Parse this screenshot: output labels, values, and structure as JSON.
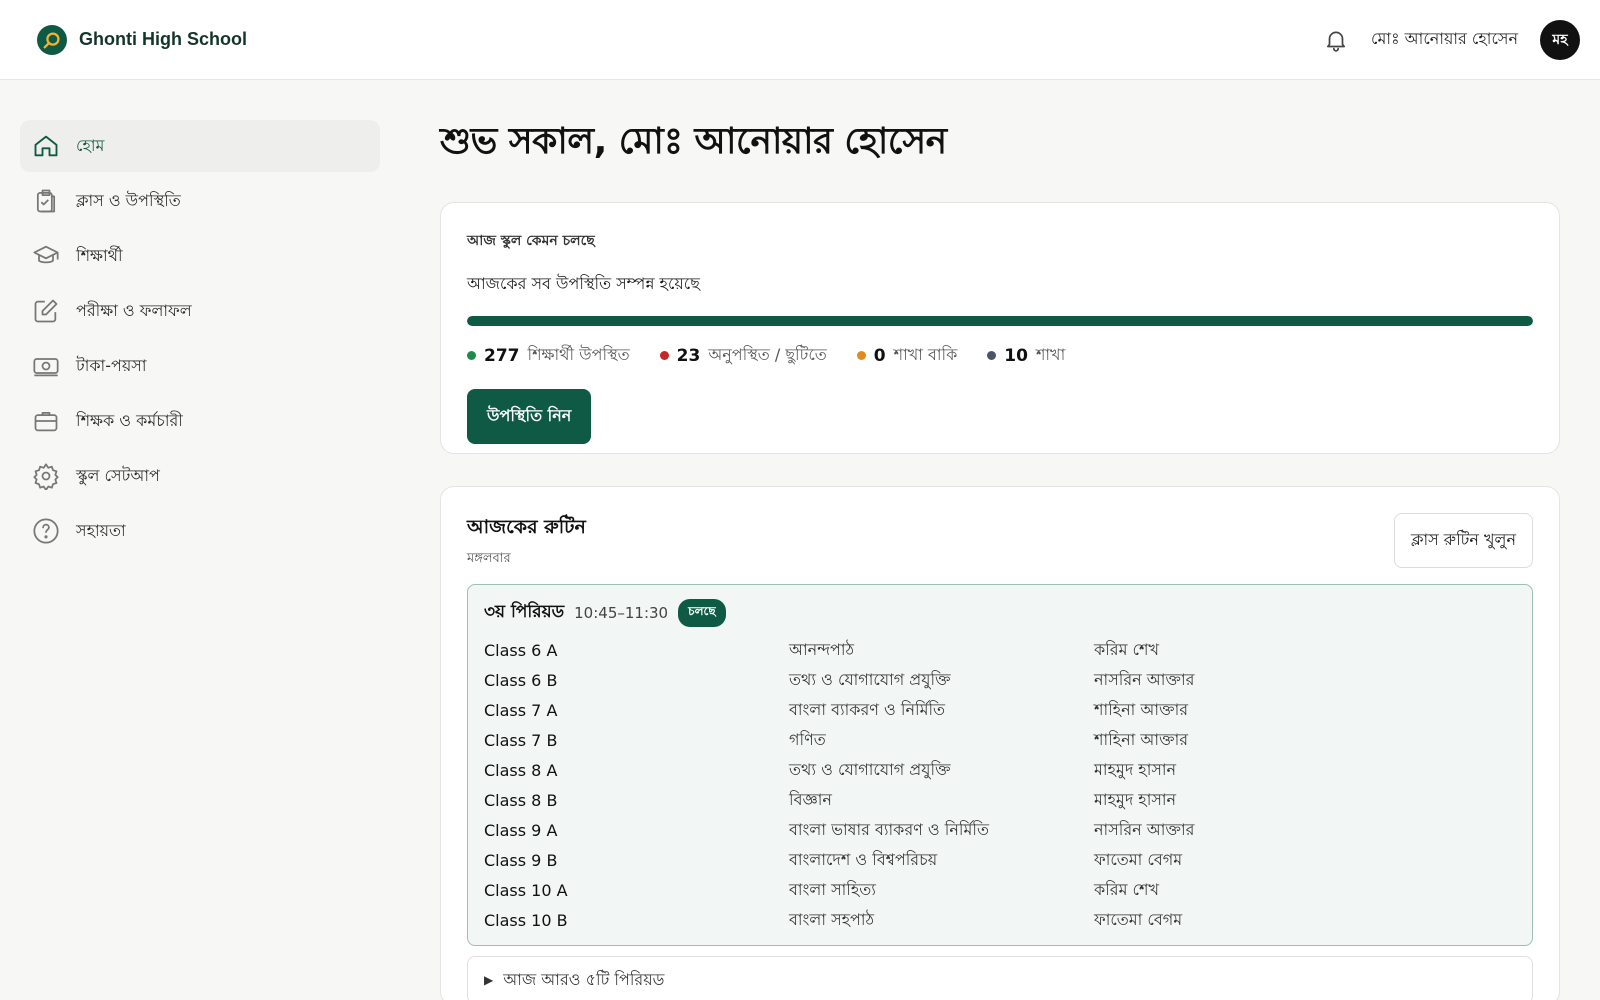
{
  "brand": {
    "name": "Ghonti High School"
  },
  "header": {
    "user_name": "মোঃ আনোয়ার হোসেন",
    "avatar_initials": "মহ"
  },
  "sidebar": {
    "items": [
      {
        "label": "হোম",
        "icon": "home-icon",
        "active": true
      },
      {
        "label": "ক্লাস ও উপস্থিতি",
        "icon": "clipboard-check-icon"
      },
      {
        "label": "শিক্ষার্থী",
        "icon": "graduation-cap-icon"
      },
      {
        "label": "পরীক্ষা ও ফলাফল",
        "icon": "pencil-square-icon"
      },
      {
        "label": "টাকা-পয়সা",
        "icon": "banknote-icon"
      },
      {
        "label": "শিক্ষক ও কর্মচারী",
        "icon": "briefcase-icon"
      },
      {
        "label": "স্কুল সেটআপ",
        "icon": "gear-icon"
      },
      {
        "label": "সহায়তা",
        "icon": "help-circle-icon"
      }
    ]
  },
  "main": {
    "greeting": "শুভ সকাল, মোঃ আনোয়ার হোসেন",
    "status": {
      "title": "আজ স্কুল কেমন চলছে",
      "message": "আজকের সব উপস্থিতি সম্পন্ন হয়েছে",
      "progress_fraction": 1.0,
      "stats": [
        {
          "value": "277",
          "label": "শিক্ষার্থী উপস্থিত",
          "color": "#1f8a4c"
        },
        {
          "value": "23",
          "label": "অনুপস্থিত / ছুটিতে",
          "color": "#c62828"
        },
        {
          "value": "0",
          "label": "শাখা বাকি",
          "color": "#e08a1e"
        },
        {
          "value": "10",
          "label": "শাখা",
          "color": "#4a5568"
        }
      ],
      "button_label": "উপস্থিতি নিন"
    },
    "routine": {
      "title": "আজকের রুটিন",
      "day": "মঙ্গলবার",
      "open_button": "ক্লাস রুটিন খুলুন",
      "current_period": {
        "name": "৩য় পিরিয়ড",
        "time": "10:45–11:30",
        "badge": "চলছে",
        "rows": [
          {
            "class": "Class 6 A",
            "subject": "আনন্দপাঠ",
            "teacher": "করিম শেখ"
          },
          {
            "class": "Class 6 B",
            "subject": "তথ্য ও যোগাযোগ প্রযুক্তি",
            "teacher": "নাসরিন আক্তার"
          },
          {
            "class": "Class 7 A",
            "subject": "বাংলা ব্যাকরণ ও নির্মিতি",
            "teacher": "শাহিনা আক্তার"
          },
          {
            "class": "Class 7 B",
            "subject": "গণিত",
            "teacher": "শাহিনা আক্তার"
          },
          {
            "class": "Class 8 A",
            "subject": "তথ্য ও যোগাযোগ প্রযুক্তি",
            "teacher": "মাহমুদ হাসান"
          },
          {
            "class": "Class 8 B",
            "subject": "বিজ্ঞান",
            "teacher": "মাহমুদ হাসান"
          },
          {
            "class": "Class 9 A",
            "subject": "বাংলা ভাষার ব্যাকরণ ও নির্মিতি",
            "teacher": "নাসরিন আক্তার"
          },
          {
            "class": "Class 9 B",
            "subject": "বাংলাদেশ ও বিশ্বপরিচয়",
            "teacher": "ফাতেমা বেগম"
          },
          {
            "class": "Class 10 A",
            "subject": "বাংলা সাহিত্য",
            "teacher": "করিম শেখ"
          },
          {
            "class": "Class 10 B",
            "subject": "বাংলা সহপাঠ",
            "teacher": "ফাতেমা বেগম"
          }
        ]
      },
      "more_periods": "আজ আরও ৫টি পিরিয়ড"
    }
  }
}
